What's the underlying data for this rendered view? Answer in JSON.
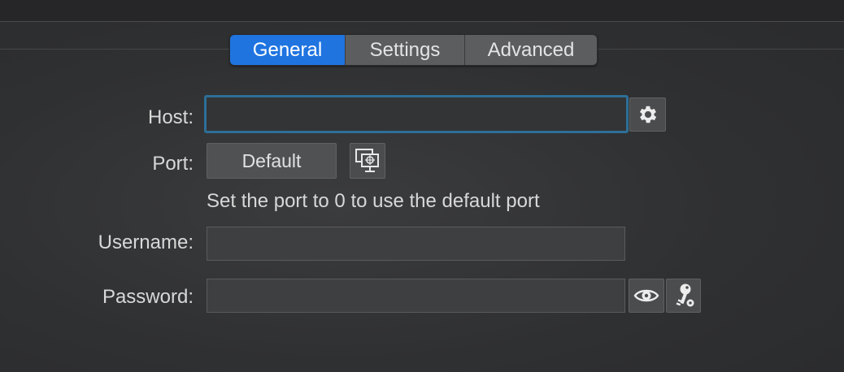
{
  "tabs": [
    {
      "label": "General",
      "active": true
    },
    {
      "label": "Settings",
      "active": false
    },
    {
      "label": "Advanced",
      "active": false
    }
  ],
  "form": {
    "host": {
      "label": "Host:",
      "value": ""
    },
    "port": {
      "label": "Port:",
      "button_label": "Default",
      "hint": "Set the port to 0 to use the default port"
    },
    "username": {
      "label": "Username:",
      "value": ""
    },
    "password": {
      "label": "Password:",
      "value": ""
    }
  },
  "icons": {
    "host_settings": "gear-icon",
    "port_picker": "network-target-icon",
    "show_password": "eye-icon",
    "keychain": "key-gear-icon"
  },
  "colors": {
    "accent": "#1f74e0",
    "focus_ring": "#2d6f98",
    "background": "#2f3032"
  }
}
